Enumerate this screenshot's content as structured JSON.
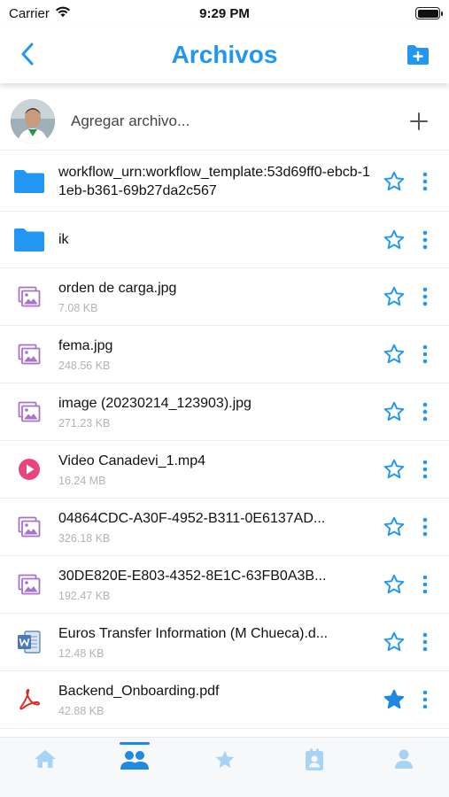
{
  "status_bar": {
    "carrier": "Carrier",
    "time": "9:29 PM"
  },
  "header": {
    "title": "Archivos"
  },
  "add_file": {
    "label": "Agregar archivo..."
  },
  "files": [
    {
      "name": "workflow_urn:workflow_template:53d69ff0-ebcb-11eb-b361-69b27da2c567",
      "size": "",
      "type": "folder",
      "starred": false
    },
    {
      "name": "ik",
      "size": "",
      "type": "folder",
      "starred": false
    },
    {
      "name": "orden de carga.jpg",
      "size": "7.08 KB",
      "type": "image",
      "starred": false
    },
    {
      "name": "fema.jpg",
      "size": "248.56 KB",
      "type": "image",
      "starred": false
    },
    {
      "name": "image (20230214_123903).jpg",
      "size": "271.23 KB",
      "type": "image",
      "starred": false
    },
    {
      "name": "Video Canadevi_1.mp4",
      "size": "16.24 MB",
      "type": "video",
      "starred": false
    },
    {
      "name": "04864CDC-A30F-4952-B311-0E6137AD...",
      "size": "326.18 KB",
      "type": "image",
      "starred": false
    },
    {
      "name": "30DE820E-E803-4352-8E1C-63FB0A3B...",
      "size": "192.47 KB",
      "type": "image",
      "starred": false
    },
    {
      "name": "Euros Transfer Information (M Chueca).d...",
      "size": "12.48 KB",
      "type": "word",
      "starred": false
    },
    {
      "name": "Backend_Onboarding.pdf",
      "size": "42.88 KB",
      "type": "pdf",
      "starred": true
    }
  ],
  "tabs": [
    {
      "icon": "home-icon",
      "active": false
    },
    {
      "icon": "people-icon",
      "active": true
    },
    {
      "icon": "star-icon",
      "active": false
    },
    {
      "icon": "contact-badge-icon",
      "active": false
    },
    {
      "icon": "person-icon",
      "active": false
    }
  ],
  "colors": {
    "accent": "#2196f3",
    "tab_inactive": "#a9d3f5",
    "image_icon": "#a874c9",
    "video_icon": "#e8457a",
    "word_icon": "#4a7ab8",
    "pdf_icon": "#d93025"
  }
}
